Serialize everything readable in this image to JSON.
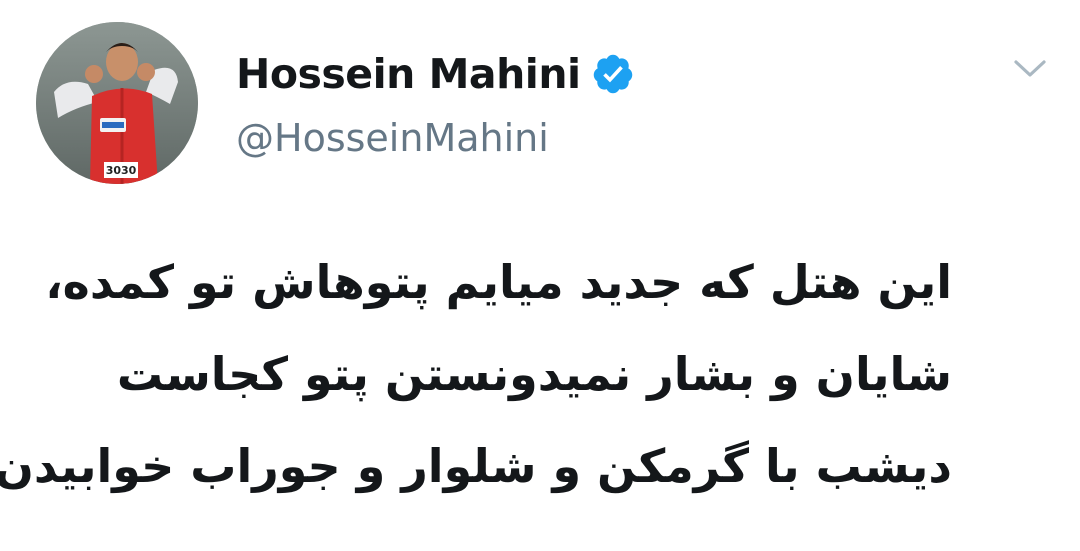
{
  "author": {
    "display_name": "Hossein Mahini",
    "handle": "@HosseinMahini",
    "verified": true,
    "avatar_icon": "profile-photo-football-player",
    "jersey_text": "3030"
  },
  "menu": {
    "icon": "chevron-down-icon"
  },
  "tweet": {
    "lines": [
      "این هتل که جدید میایم پتوهاش تو کمده،",
      "شایان و بشار نمیدونستن پتو کجاست",
      "دیشب با گرمکن و شلوار و جوراب خوابیدن"
    ]
  },
  "colors": {
    "text": "#14171a",
    "secondary": "#657786",
    "verified": "#1da1f2",
    "chevron": "#aab8c2"
  }
}
